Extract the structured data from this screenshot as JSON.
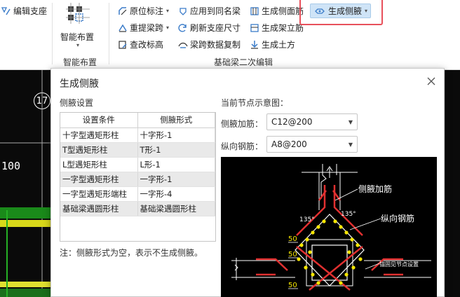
{
  "ribbon": {
    "edit_support_label": "编辑支座",
    "smart_layout_label": "智能布置",
    "smart_layout_group": "智能布置",
    "original_mark_label": "原位标注",
    "re_extract_span_label": "重提梁跨",
    "check_mark_label": "查改标高",
    "apply_same_name_label": "应用到同名梁",
    "refresh_support_label": "刷新支座尺寸",
    "beam_span_copy_label": "梁跨数据复制",
    "gen_side_rebar_label": "生成侧面筋",
    "gen_stirrup_label": "生成架立筋",
    "gen_earthwork_label": "生成土方",
    "gen_haunch_label": "生成侧腋",
    "foundation_group": "基础梁二次编辑"
  },
  "cad": {
    "number_text": "100",
    "circle_text": "17"
  },
  "dialog": {
    "title": "生成侧腋",
    "left_section_title": "侧腋设置",
    "table": {
      "headers": [
        "设置条件",
        "侧腋形式"
      ],
      "rows": [
        [
          "十字型遇矩形柱",
          "十字形-1"
        ],
        [
          "T型遇矩形柱",
          "T形-1"
        ],
        [
          "L型遇矩形柱",
          "L形-1"
        ],
        [
          "一字型遇矩形柱",
          "一字形-1"
        ],
        [
          "一字型遇矩形端柱",
          "一字形-4"
        ],
        [
          "基础梁遇圆形柱",
          "基础梁遇圆形柱"
        ]
      ]
    },
    "note": "注：侧腋形式为空，表示不生成侧腋。",
    "right_section_title": "当前节点示意图：",
    "haunch_rebar_label": "侧腋加筋：",
    "haunch_rebar_value": "C12@200",
    "longitudinal_label": "纵向钢筋：",
    "longitudinal_value": "A8@200",
    "diagram": {
      "label_haunch": "侧腋加筋",
      "label_longitudinal": "纵向钢筋",
      "label_angle_a": "135°",
      "label_angle_b": "135°",
      "label_50_a": "50",
      "label_50_b": "50",
      "label_50_c": "50",
      "label_side": "锚固见节点设置"
    }
  },
  "colors": {
    "ribbon_highlight": "#cfe4f7",
    "red_frame": "#e8505b",
    "rebar_red": "#e03030",
    "rebar_dot": "#f5e600",
    "cad_background": "#0a0a0a"
  }
}
